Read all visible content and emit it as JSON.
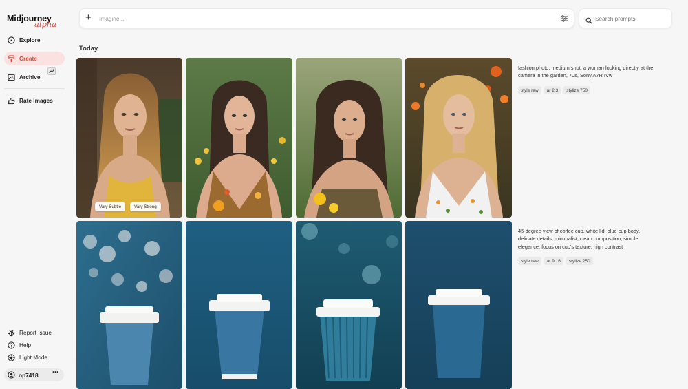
{
  "app": {
    "name": "Midjourney",
    "badge": "alpha"
  },
  "sidebar": {
    "items": [
      {
        "label": "Explore",
        "icon": "compass-icon"
      },
      {
        "label": "Create",
        "icon": "brush-icon",
        "active": true
      },
      {
        "label": "Archive",
        "icon": "image-icon"
      },
      {
        "label": "Rate Images",
        "icon": "thumbs-up-icon"
      }
    ],
    "bottom": [
      {
        "label": "Report Issue",
        "icon": "bug-icon"
      },
      {
        "label": "Help",
        "icon": "help-circle-icon"
      },
      {
        "label": "Light Mode",
        "icon": "sun-icon"
      }
    ],
    "user": {
      "name": "op7418",
      "menu": "•••"
    }
  },
  "topbar": {
    "imagine_placeholder": "Imagine...",
    "search_placeholder": "Search prompts"
  },
  "feed": {
    "section_title": "Today",
    "jobs": [
      {
        "prompt": "fashion photo, medium shot, a woman looking directly at the camera in the garden, 70s, Sony A7R IVw",
        "tags": [
          "style raw",
          "ar 2:3",
          "stylize 750"
        ],
        "images": [
          "woman-garden-1",
          "woman-garden-2",
          "woman-garden-3",
          "woman-garden-4"
        ],
        "hover_actions": [
          "Vary Subtle",
          "Vary Strong"
        ]
      },
      {
        "prompt": "45-degree view of coffee cup, white lid, blue cup body, delicate details, minimalist, clean composition, simple elegance, focus on cup's texture, high contrast",
        "tags": [
          "style raw",
          "ar 9:16",
          "stylize 250"
        ],
        "images": [
          "coffee-cup-1",
          "coffee-cup-2",
          "coffee-cup-3",
          "coffee-cup-4"
        ]
      }
    ]
  },
  "colors": {
    "accent": "#e04a3a",
    "active_bg": "#fbe1df",
    "cup_bg": "#1f5f82"
  }
}
